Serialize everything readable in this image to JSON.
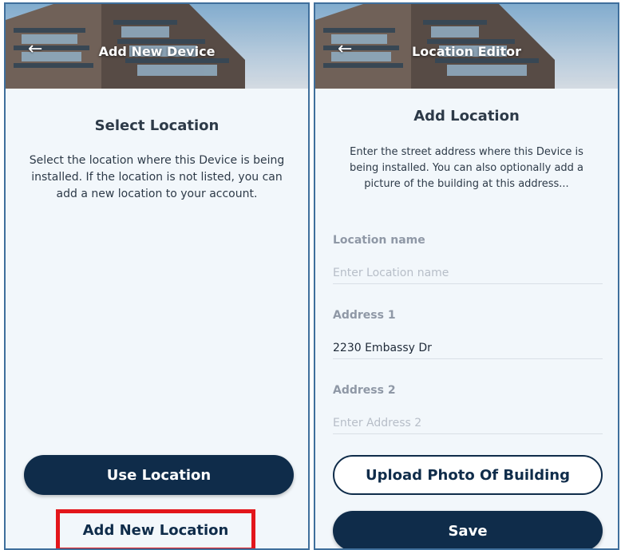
{
  "left_screen": {
    "header_title": "Add New Device",
    "heading": "Select Location",
    "description": "Select the location where this Device is being installed. If the location is not listed, you can add a new location to your account.",
    "use_location_label": "Use Location",
    "add_new_location_label": "Add New Location"
  },
  "right_screen": {
    "header_title": "Location Editor",
    "heading": "Add Location",
    "description": "Enter the street address where this Device is being installed. You can also optionally add a picture of the building at this address...",
    "fields": [
      {
        "label": "Location name",
        "value": "",
        "placeholder": "Enter Location name"
      },
      {
        "label": "Address 1",
        "value": "2230 Embassy Dr",
        "placeholder": ""
      },
      {
        "label": "Address 2",
        "value": "",
        "placeholder": "Enter Address 2"
      }
    ],
    "upload_label": "Upload Photo Of Building",
    "save_label": "Save"
  },
  "colors": {
    "primary_dark": "#0f2c4a",
    "panel_bg": "#f2f7fb",
    "highlight": "#e3161b"
  },
  "icons": {
    "back": "left-arrow-icon"
  }
}
